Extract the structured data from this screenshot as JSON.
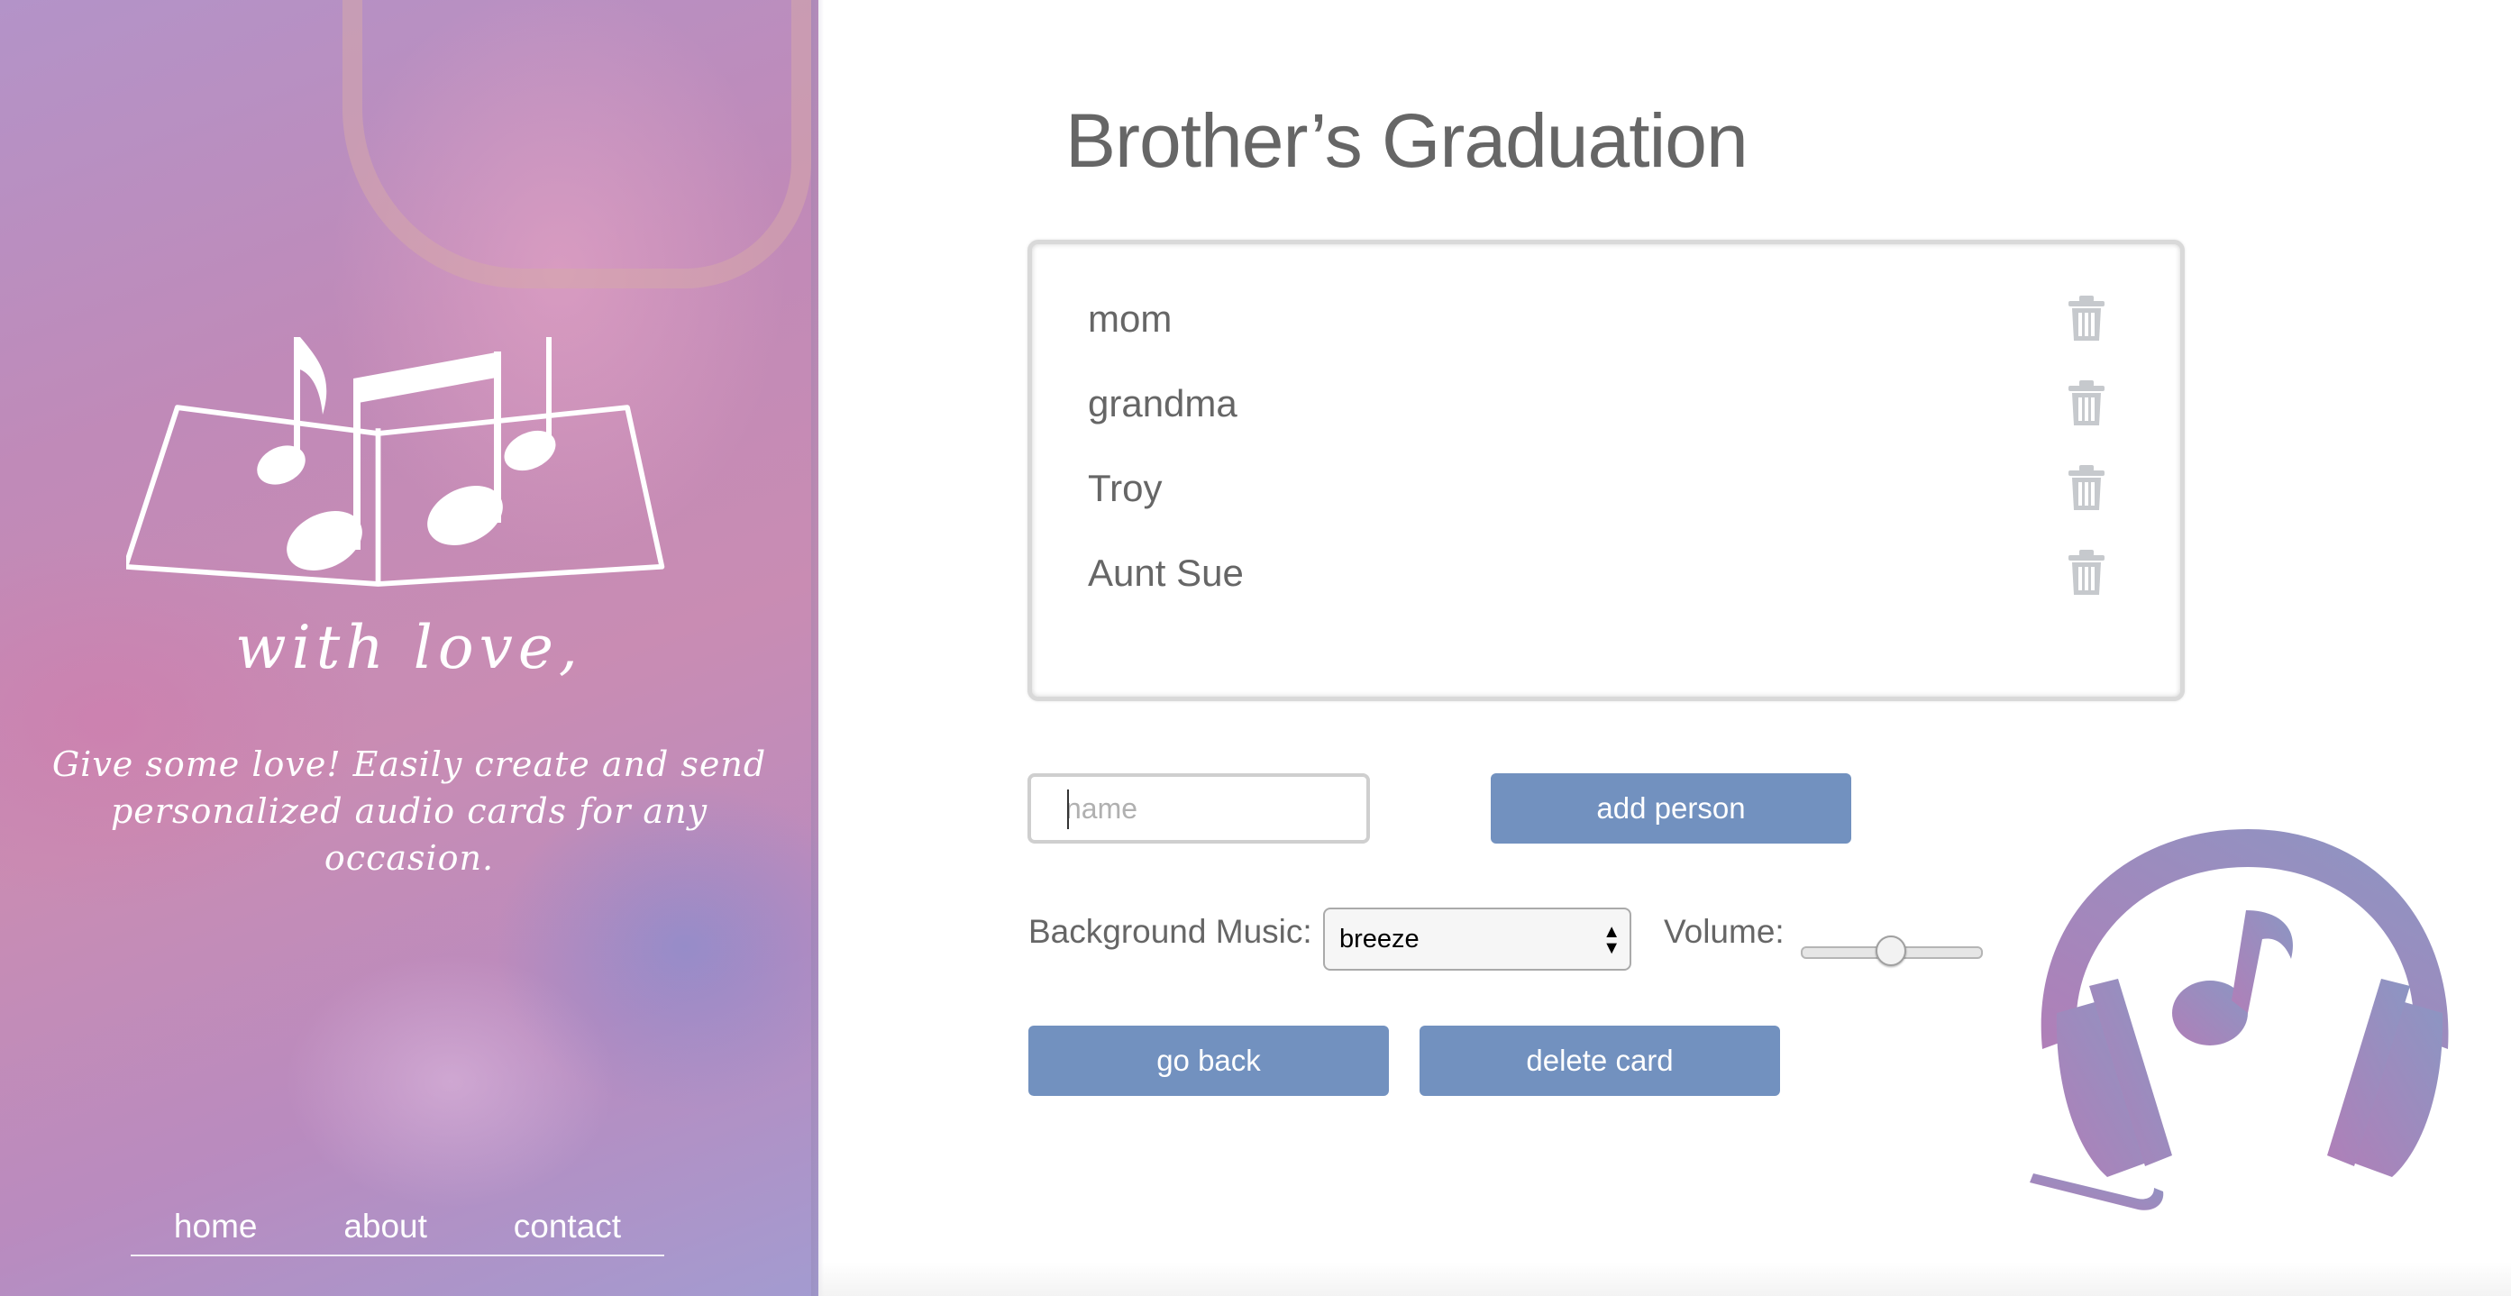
{
  "sidebar": {
    "brand_title": "with love,",
    "brand_text": "Give some love! Easily create and send personalized audio cards for any occasion.",
    "nav": {
      "home": "home",
      "about": "about",
      "contact": "contact"
    }
  },
  "card": {
    "title": "Brother’s Graduation",
    "people": [
      "mom",
      "grandma",
      "Troy",
      "Aunt Sue"
    ]
  },
  "form": {
    "name_placeholder": "name",
    "add_person_label": "add person",
    "background_music_label": "Background Music:",
    "background_music_value": "breeze",
    "volume_label": "Volume:",
    "volume_level": 0.5,
    "go_back_label": "go back",
    "delete_card_label": "delete card"
  },
  "colors": {
    "accent": "#7291bf",
    "text_gray": "#666666",
    "headphones_gradient": [
      "#8b96c3",
      "#b07fb8"
    ]
  }
}
